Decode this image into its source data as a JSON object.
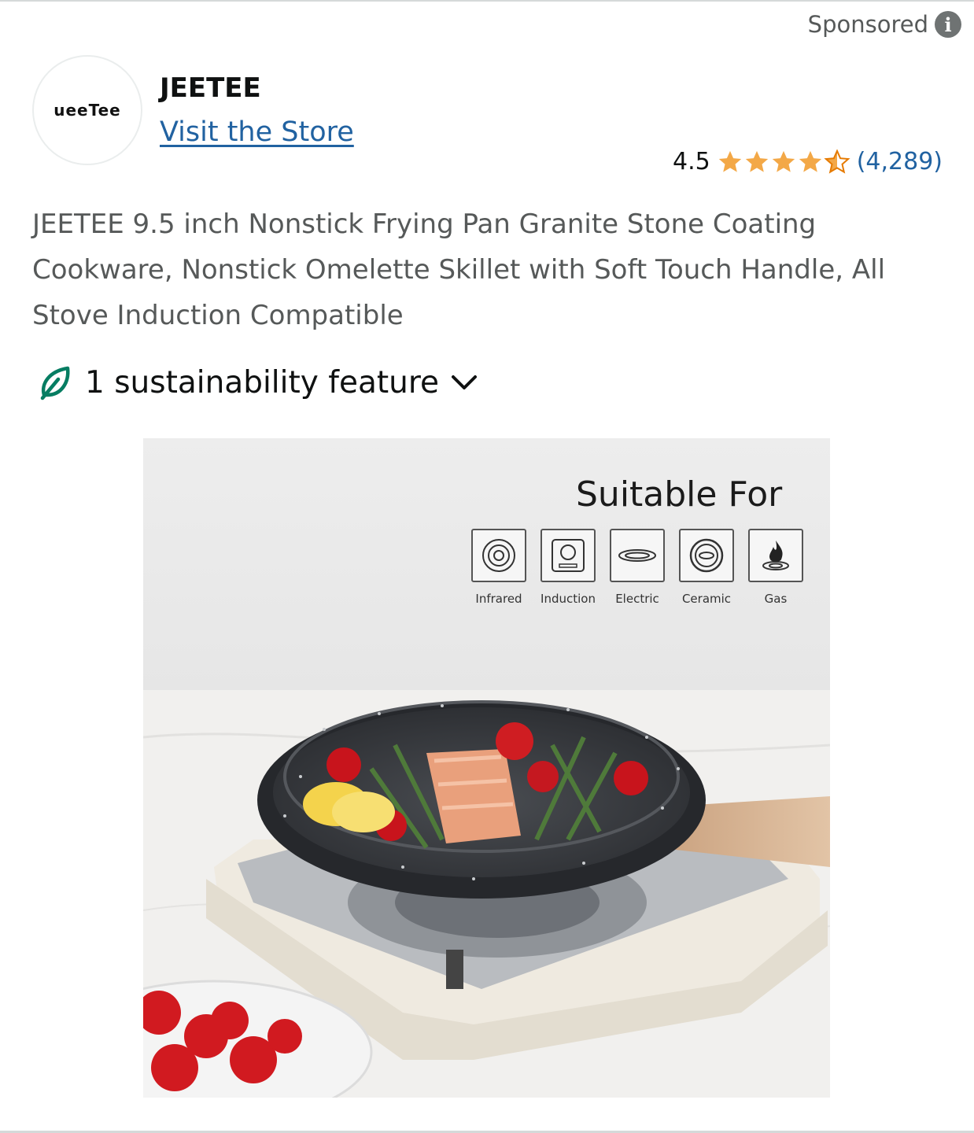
{
  "ad": {
    "sponsored_label": "Sponsored",
    "info_icon": "i"
  },
  "brand": {
    "logo_text": "ueeTee",
    "name": "JEETEE",
    "store_link": "Visit the Store"
  },
  "rating": {
    "value": "4.5",
    "stars": 4.5,
    "max_stars": 5,
    "count": "(4,289)",
    "star_color": "#f3a847"
  },
  "product": {
    "title": "JEETEE 9.5 inch Nonstick Frying Pan Granite Stone Coating Cookware, Nonstick Omelette Skillet with Soft Touch Handle, All Stove Induction Compatible"
  },
  "sustainability": {
    "label": "1 sustainability feature",
    "icon": "leaf-icon",
    "icon_color": "#067d62"
  },
  "image": {
    "heading": "Suitable For",
    "stoves": [
      {
        "label": "Infrared",
        "icon": "infrared-icon"
      },
      {
        "label": "Induction",
        "icon": "induction-icon"
      },
      {
        "label": "Electric",
        "icon": "electric-icon"
      },
      {
        "label": "Ceramic",
        "icon": "ceramic-icon"
      },
      {
        "label": "Gas",
        "icon": "gas-flame-icon"
      }
    ]
  },
  "colors": {
    "link": "#2162a1",
    "muted_text": "#565959",
    "text": "#0f1111"
  }
}
